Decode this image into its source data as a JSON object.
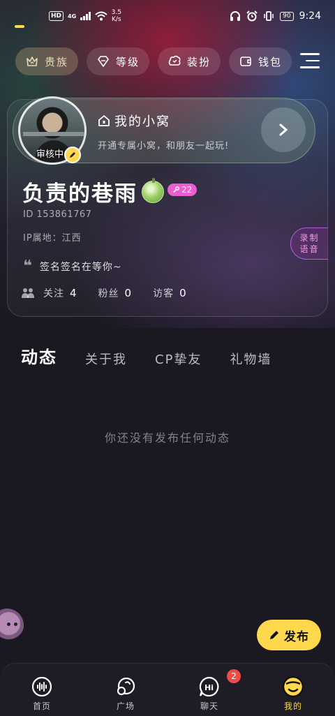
{
  "status_bar": {
    "hd": "HD",
    "network": "4G",
    "speed_value": "3.5",
    "speed_unit": "K/s",
    "battery": "90",
    "time": "9:24"
  },
  "top_nav": {
    "items": [
      {
        "label": "贵族",
        "icon": "crown-icon",
        "active": true
      },
      {
        "label": "等级",
        "icon": "gem-icon",
        "active": false
      },
      {
        "label": "装扮",
        "icon": "cloud-tag-icon",
        "active": false
      },
      {
        "label": "钱包",
        "icon": "wallet-icon",
        "active": false
      }
    ]
  },
  "nest": {
    "title": "我的小窝",
    "subtitle": "开通专属小窝，和朋友一起玩!"
  },
  "profile": {
    "review_status": "审核中",
    "username": "负责的巷雨",
    "level": "22",
    "id_text": "ID  153861767",
    "ip_text": "IP属地：江西",
    "record_voice": "录制\n语音",
    "signature": "签名签名在等你~",
    "following_label": "关注",
    "following_count": "4",
    "fans_label": "粉丝",
    "fans_count": "0",
    "visitors_label": "访客",
    "visitors_count": "0"
  },
  "tabs": [
    {
      "label": "动态",
      "active": true
    },
    {
      "label": "关于我",
      "active": false
    },
    {
      "label": "CP挚友",
      "active": false
    },
    {
      "label": "礼物墙",
      "active": false
    }
  ],
  "empty_text": "你还没有发布任何动态",
  "publish_label": "发布",
  "bottom_nav": {
    "items": [
      {
        "label": "首页",
        "icon": "home-sound-icon",
        "active": false
      },
      {
        "label": "广场",
        "icon": "planet-icon",
        "active": false
      },
      {
        "label": "聊天",
        "icon": "chat-hi-icon",
        "active": false,
        "badge": "2"
      },
      {
        "label": "我的",
        "icon": "profile-face-icon",
        "active": true
      }
    ]
  },
  "colors": {
    "accent_yellow": "#ffd84d",
    "level_pink": "#e85fd0",
    "badge_red": "#f04a4a"
  }
}
